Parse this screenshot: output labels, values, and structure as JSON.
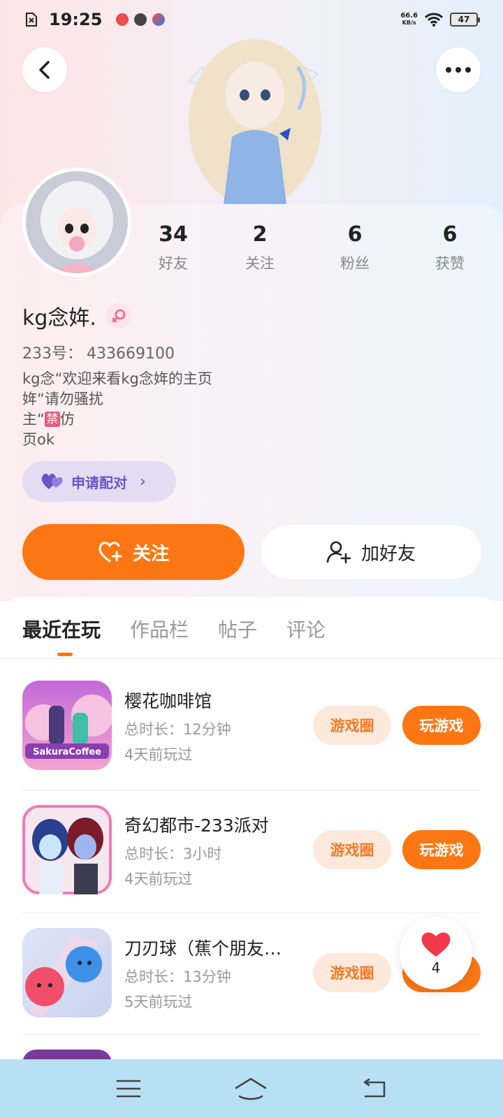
{
  "status_bar": {
    "time": "19:25",
    "net_speed_value": "66.6",
    "net_speed_unit": "KB/s",
    "battery": "47"
  },
  "profile": {
    "nickname": "kg念姩.",
    "id_label": "233号：",
    "id_value": "433669100",
    "bio_lines": [
      "kg念“欢迎来看kg念姩的主页",
      "姩“请勿骚扰",
      "主“",
      "页ok"
    ],
    "bio_ban_badge": "禁",
    "bio_line3_suffix": "仿",
    "stats": [
      {
        "value": "34",
        "label": "好友"
      },
      {
        "value": "2",
        "label": "关注"
      },
      {
        "value": "6",
        "label": "粉丝"
      },
      {
        "value": "6",
        "label": "获赞"
      }
    ]
  },
  "actions": {
    "pair_label": "申请配对",
    "follow_label": "关注",
    "add_friend_label": "加好友"
  },
  "tabs": [
    {
      "label": "最近在玩",
      "active": true
    },
    {
      "label": "作品栏",
      "active": false
    },
    {
      "label": "帖子",
      "active": false
    },
    {
      "label": "评论",
      "active": false
    }
  ],
  "games": [
    {
      "title": "樱花咖啡馆",
      "duration": "总时长：12分钟",
      "last_played": "4天前玩过",
      "circle_label": "游戏圈",
      "play_label": "玩游戏",
      "icon_text": "SakuraCoffee"
    },
    {
      "title": "奇幻都市-233派对",
      "duration": "总时长：3小时",
      "last_played": "4天前玩过",
      "circle_label": "游戏圈",
      "play_label": "玩游戏"
    },
    {
      "title": "刀刃球（蕉个朋友…",
      "duration": "总时长：13分钟",
      "last_played": "5天前玩过",
      "circle_label": "游戏圈",
      "play_label": "玩游戏"
    }
  ],
  "like_float": {
    "count": "4"
  },
  "colors": {
    "accent": "#fc7713",
    "pair_purple": "#6a55c8",
    "nav_bar": "#b8e0f4"
  }
}
